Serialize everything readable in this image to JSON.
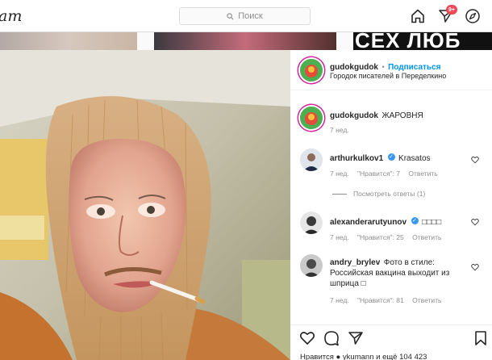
{
  "nav": {
    "logo_text": "am",
    "search_placeholder": "Поиск",
    "notifications_badge": "9+"
  },
  "background": {
    "banner_text": "СЕХ ЛЮБ"
  },
  "post": {
    "header": {
      "username": "gudokgudok",
      "separator": "•",
      "follow_label": "Подписаться",
      "location": "Городок писателей в Переделкино"
    },
    "caption": {
      "username": "gudokgudok",
      "text": "ЖАРОВНЯ",
      "time": "7 нед."
    },
    "comments": [
      {
        "username": "arthurkulkov1",
        "verified": true,
        "text": "Krasatos",
        "time": "7 нед.",
        "likes": "\"Нравится\": 7",
        "reply": "Ответить",
        "view_replies": "Посмотреть ответы (1)"
      },
      {
        "username": "alexanderarutyunov",
        "verified": true,
        "text": "□□□□",
        "time": "7 нед.",
        "likes": "\"Нравится\": 25",
        "reply": "Ответить"
      },
      {
        "username": "andry_brylev",
        "verified": false,
        "text_line1": "Фото в стиле:",
        "text_line2": "Российская вакцина выходит из",
        "text_line3": "шприца □",
        "time": "7 нед.",
        "likes": "\"Нравится\": 81",
        "reply": "Ответить"
      }
    ],
    "likes_text": "Нравится ● ykumann и ещё 104 423"
  },
  "icons": [
    "home-icon",
    "direct-icon",
    "explore-icon",
    "search-icon",
    "heart-icon",
    "comment-icon",
    "share-icon",
    "bookmark-icon",
    "verified-icon"
  ],
  "colors": {
    "accent": "#0095f6",
    "badge": "#ed4956",
    "verified": "#3897f0"
  }
}
